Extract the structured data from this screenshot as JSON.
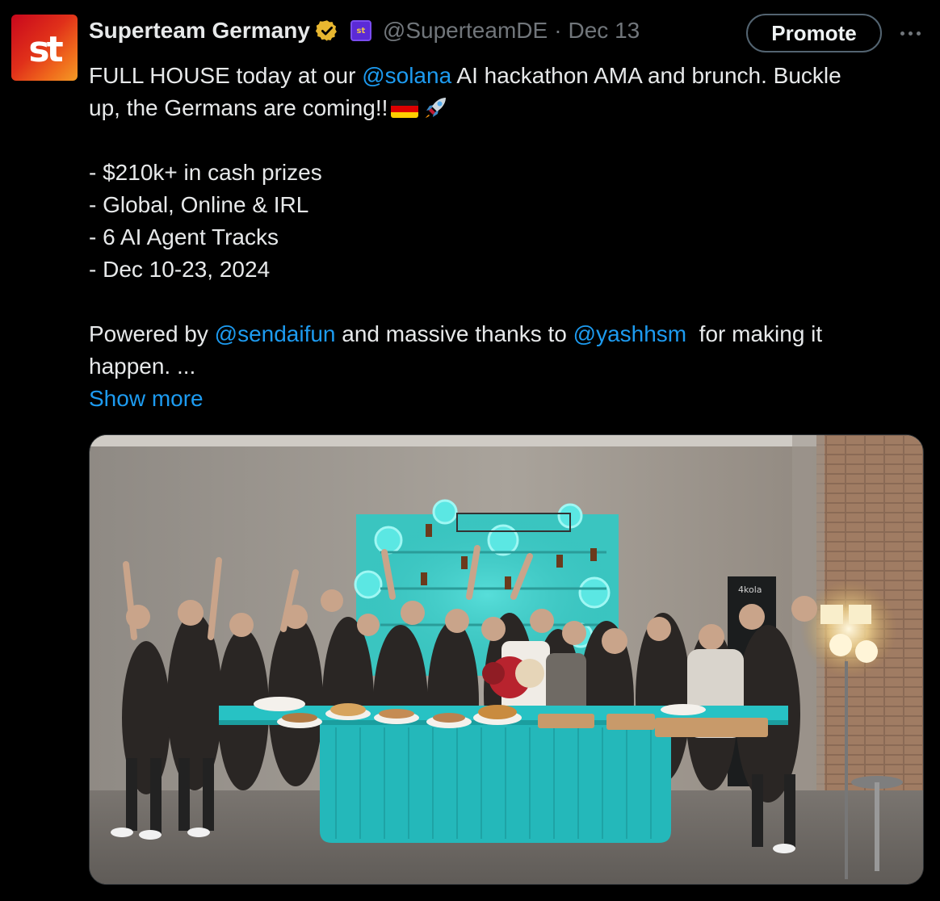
{
  "tweet": {
    "author": {
      "display_name": "Superteam Germany",
      "handle": "@SuperteamDE",
      "avatar_icon": "superteam-st-logo",
      "verified_icon": "gold-verified-badge-icon",
      "affiliate_badge_icon": "superteam-affiliate-badge-icon"
    },
    "separator": "·",
    "date": "Dec 13",
    "promote_label": "Promote",
    "more_icon": "more-dots-icon",
    "text": {
      "line1_prefix": "FULL HOUSE today at our ",
      "line1_mention": "@solana",
      "line1_suffix": " AI hackathon AMA and brunch. Buckle",
      "line2": "up, the Germans are coming!!",
      "bullets": [
        "- $210k+ in cash prizes",
        "- Global, Online & IRL",
        "- 6 AI Agent Tracks",
        "- Dec 10-23, 2024"
      ],
      "powered_prefix": "Powered by ",
      "powered_mention1": "@sendaifun",
      "powered_middle": " and massive thanks to ",
      "powered_mention2": "@yashhsm",
      "powered_suffix": "  for making it",
      "last_line": "happen. ..."
    },
    "emojis": [
      "germany-flag-icon",
      "rocket-icon"
    ],
    "show_more_label": "Show more",
    "media": {
      "type": "photo",
      "sign_text": "4kola"
    }
  },
  "colors": {
    "background": "#000000",
    "text_primary": "#e7e9ea",
    "text_secondary": "#71767b",
    "link": "#1d9bf0",
    "promote_border": "#536471",
    "table_turquoise": "#27c2c4"
  }
}
